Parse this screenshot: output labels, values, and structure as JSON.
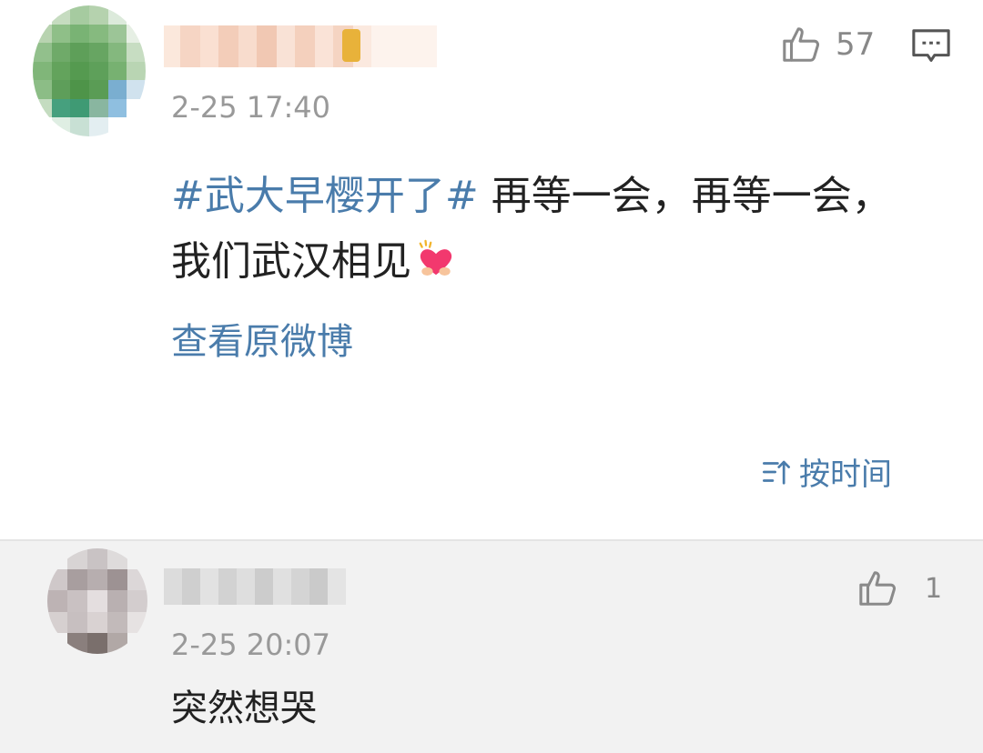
{
  "main_post": {
    "timestamp": "2-25 17:40",
    "like_count": "57",
    "hashtag": "#武大早樱开了#",
    "text_line1": " 再等一会，再等一会，",
    "text_line2": "我们武汉相见",
    "view_original": "查看原微博",
    "sort_label": "按时间"
  },
  "reply": {
    "timestamp": "2-25 20:07",
    "like_count": "1",
    "text": "突然想哭"
  },
  "colors": {
    "link": "#4a7cab",
    "meta": "#999999",
    "reply_bg": "#f2f2f2"
  },
  "icons": [
    "thumbs-up-icon",
    "comment-icon",
    "sort-icon",
    "heart-hands-emoji"
  ]
}
